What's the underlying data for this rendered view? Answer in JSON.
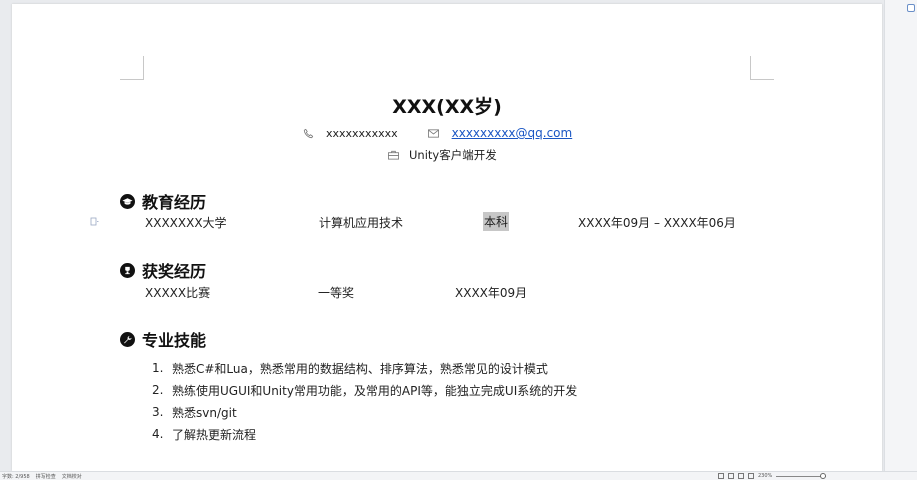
{
  "resume": {
    "name": "XXX(XX岁)",
    "phone": "xxxxxxxxxxx",
    "email": "xxxxxxxxx@qq.com",
    "job": "Unity客户端开发"
  },
  "education": {
    "heading": "教育经历",
    "school": "XXXXXXX大学",
    "major": "计算机应用技术",
    "degree": "本科",
    "period": "XXXX年09月 – XXXX年06月"
  },
  "awards": {
    "heading": "获奖经历",
    "name": "XXXXX比赛",
    "level": "一等奖",
    "date": "XXXX年09月"
  },
  "skills": {
    "heading": "专业技能",
    "items": [
      {
        "num": "1.",
        "text": "熟悉C#和Lua，熟悉常用的数据结构、排序算法，熟悉常见的设计模式"
      },
      {
        "num": "2.",
        "text": "熟练使用UGUI和Unity常用功能，及常用的API等，能独立完成UI系统的开发"
      },
      {
        "num": "3.",
        "text": "熟悉svn/git"
      },
      {
        "num": "4.",
        "text": "了解热更新流程"
      }
    ]
  },
  "statusbar": {
    "page_info": "字数: 2/958",
    "spellcheck": "拼写检查",
    "doc_check": "文档校对",
    "zoom": "230%"
  }
}
